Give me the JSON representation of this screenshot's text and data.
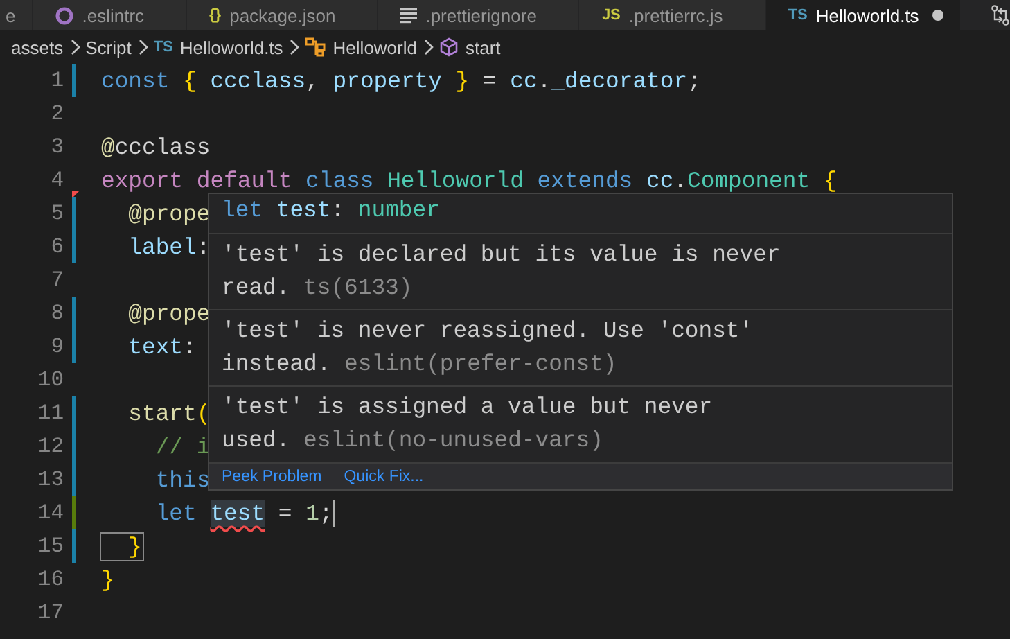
{
  "tabs": [
    {
      "label": "e",
      "selected": false,
      "dirty": false
    },
    {
      "icon": {
        "kind": "circle",
        "color": "#a074c4"
      },
      "label": ".eslintrc",
      "selected": false,
      "dirty": false
    },
    {
      "icon": {
        "kind": "glyph",
        "text": "{}",
        "color": "#cbcb41"
      },
      "label": "package.json",
      "selected": false,
      "dirty": false
    },
    {
      "icon": {
        "kind": "lines",
        "color": "#c5c5c5"
      },
      "label": ".prettierignore",
      "selected": false,
      "dirty": false
    },
    {
      "icon": {
        "kind": "glyph",
        "text": "JS",
        "color": "#cbcb41"
      },
      "label": ".prettierrc.js",
      "selected": false,
      "dirty": false
    },
    {
      "icon": {
        "kind": "glyph",
        "text": "TS",
        "color": "#519aba"
      },
      "label": "Helloworld.ts",
      "selected": true,
      "dirty": true
    }
  ],
  "breadcrumbs": [
    {
      "label": "assets"
    },
    {
      "label": "Script"
    },
    {
      "icon": {
        "kind": "glyph",
        "text": "TS"
      },
      "label": "Helloworld.ts"
    },
    {
      "icon": {
        "kind": "class"
      },
      "label": "Helloworld"
    },
    {
      "icon": {
        "kind": "method"
      },
      "label": "start"
    }
  ],
  "lines": [
    {
      "number": "1",
      "marker": {
        "kind": "bar",
        "color": "#1b81a8"
      },
      "tokens": [
        {
          "text": "const ",
          "kind": "keyword"
        },
        {
          "text": "{",
          "kind": "bracket"
        },
        {
          "text": " ccclass",
          "kind": "variable"
        },
        {
          "text": ", ",
          "kind": "plain"
        },
        {
          "text": "property ",
          "kind": "variable"
        },
        {
          "text": "}",
          "kind": "bracket"
        },
        {
          "text": " = ",
          "kind": "plain"
        },
        {
          "text": "cc",
          "kind": "variable"
        },
        {
          "text": ".",
          "kind": "plain"
        },
        {
          "text": "_decorator",
          "kind": "variable"
        },
        {
          "text": ";",
          "kind": "plain"
        }
      ]
    },
    {
      "number": "2"
    },
    {
      "number": "3",
      "tokens": [
        {
          "text": "@",
          "kind": "function"
        },
        {
          "text": "ccclass",
          "kind": "plain"
        }
      ]
    },
    {
      "number": "4",
      "marker": {
        "kind": "triangle",
        "color": "#f14c4c"
      },
      "tokens": [
        {
          "text": "export default",
          "kind": "control"
        },
        {
          "text": " class ",
          "kind": "keyword"
        },
        {
          "text": "Helloworld",
          "kind": "type"
        },
        {
          "text": " extends ",
          "kind": "keyword"
        },
        {
          "text": "cc",
          "kind": "variable"
        },
        {
          "text": ".",
          "kind": "plain"
        },
        {
          "text": "Component",
          "kind": "type"
        },
        {
          "text": " {",
          "kind": "bracket"
        }
      ]
    },
    {
      "number": "5",
      "marker": {
        "kind": "bar",
        "color": "#1b81a8"
      },
      "tokens": [
        {
          "text": "  @prope",
          "kind": "function"
        }
      ]
    },
    {
      "number": "6",
      "marker": {
        "kind": "bar",
        "color": "#1b81a8"
      },
      "tokens": [
        {
          "text": "  label",
          "kind": "variable"
        },
        {
          "text": ":",
          "kind": "plain"
        }
      ]
    },
    {
      "number": "7"
    },
    {
      "number": "8",
      "marker": {
        "kind": "bar",
        "color": "#1b81a8"
      },
      "tokens": [
        {
          "text": "  @prope",
          "kind": "function"
        }
      ]
    },
    {
      "number": "9",
      "marker": {
        "kind": "bar",
        "color": "#1b81a8"
      },
      "tokens": [
        {
          "text": "  text",
          "kind": "variable"
        },
        {
          "text": ":",
          "kind": "plain"
        }
      ]
    },
    {
      "number": "10"
    },
    {
      "number": "11",
      "marker": {
        "kind": "bar",
        "color": "#1b81a8"
      },
      "tokens": [
        {
          "text": "  start",
          "kind": "function"
        },
        {
          "text": "(",
          "kind": "bracket"
        }
      ]
    },
    {
      "number": "12",
      "marker": {
        "kind": "bar",
        "color": "#1b81a8"
      },
      "tokens": [
        {
          "text": "    // i",
          "kind": "comment"
        }
      ]
    },
    {
      "number": "13",
      "marker": {
        "kind": "bar",
        "color": "#1b81a8"
      },
      "tokens": [
        {
          "text": "    this",
          "kind": "keyword"
        }
      ]
    },
    {
      "number": "14",
      "marker": {
        "kind": "bar",
        "color": "#587c0c"
      },
      "tokens": [
        {
          "text": "    let ",
          "kind": "keyword"
        },
        {
          "text": "test",
          "kind": "variable",
          "error": true
        },
        {
          "text": " = ",
          "kind": "plain"
        },
        {
          "text": "1",
          "kind": "number"
        },
        {
          "text": ";",
          "kind": "plain",
          "caret": true
        }
      ]
    },
    {
      "number": "15",
      "marker": {
        "kind": "bar",
        "color": "#1b81a8"
      },
      "tokens": [
        {
          "text": "  }",
          "kind": "bracket",
          "matched": true
        }
      ]
    },
    {
      "number": "16",
      "tokens": [
        {
          "text": "}",
          "kind": "bracket"
        }
      ]
    },
    {
      "number": "17"
    }
  ],
  "hover": {
    "signature": [
      {
        "text": "let",
        "kind": "keyword"
      },
      {
        "text": " test",
        "kind": "variable"
      },
      {
        "text": ": ",
        "kind": "plain"
      },
      {
        "text": "number",
        "kind": "type"
      }
    ],
    "problems": [
      {
        "message": "'test' is declared but its value is never read.",
        "source": "ts(6133)"
      },
      {
        "message": "'test' is never reassigned. Use 'const' instead.",
        "source": "eslint(prefer-const)"
      },
      {
        "message": "'test' is assigned a value but never used.",
        "source": "eslint(no-unused-vars)"
      }
    ],
    "actions": [
      "Peek Problem",
      "Quick Fix..."
    ]
  }
}
